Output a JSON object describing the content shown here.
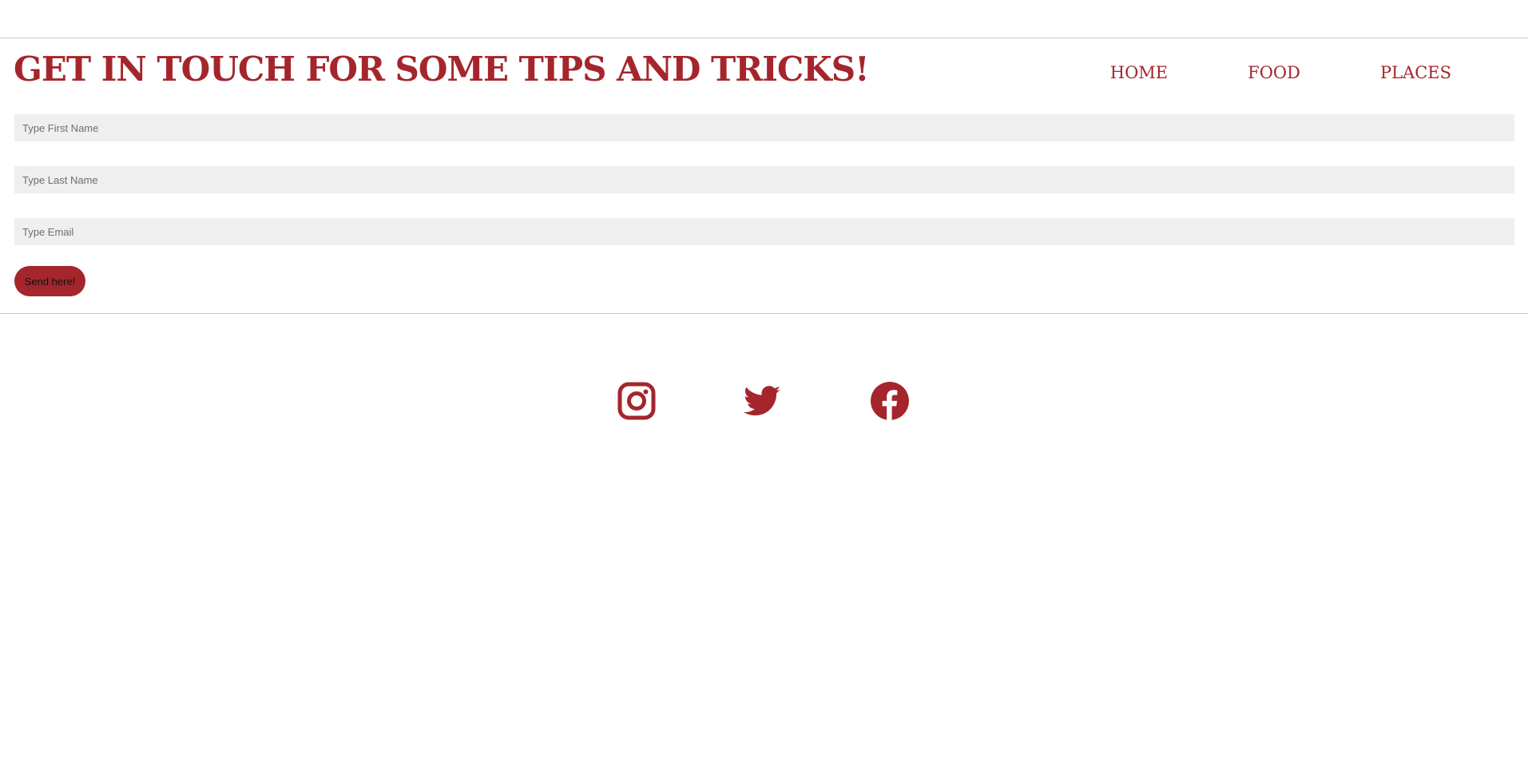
{
  "colors": {
    "accent": "#a4262c",
    "field_background": "#efefef",
    "rule": "#c8c8c8",
    "page_background": "#ffffff"
  },
  "header": {
    "title": "GET IN TOUCH FOR SOME TIPS AND TRICKS!"
  },
  "nav": {
    "items": [
      {
        "label": "HOME"
      },
      {
        "label": "FOOD"
      },
      {
        "label": "PLACES"
      }
    ]
  },
  "form": {
    "first_name": {
      "placeholder": "Type First Name",
      "value": ""
    },
    "last_name": {
      "placeholder": "Type Last Name",
      "value": ""
    },
    "email": {
      "placeholder": "Type Email",
      "value": ""
    },
    "submit_label": "Send here!"
  },
  "social": {
    "icons": [
      "instagram-icon",
      "twitter-icon",
      "facebook-icon"
    ]
  }
}
